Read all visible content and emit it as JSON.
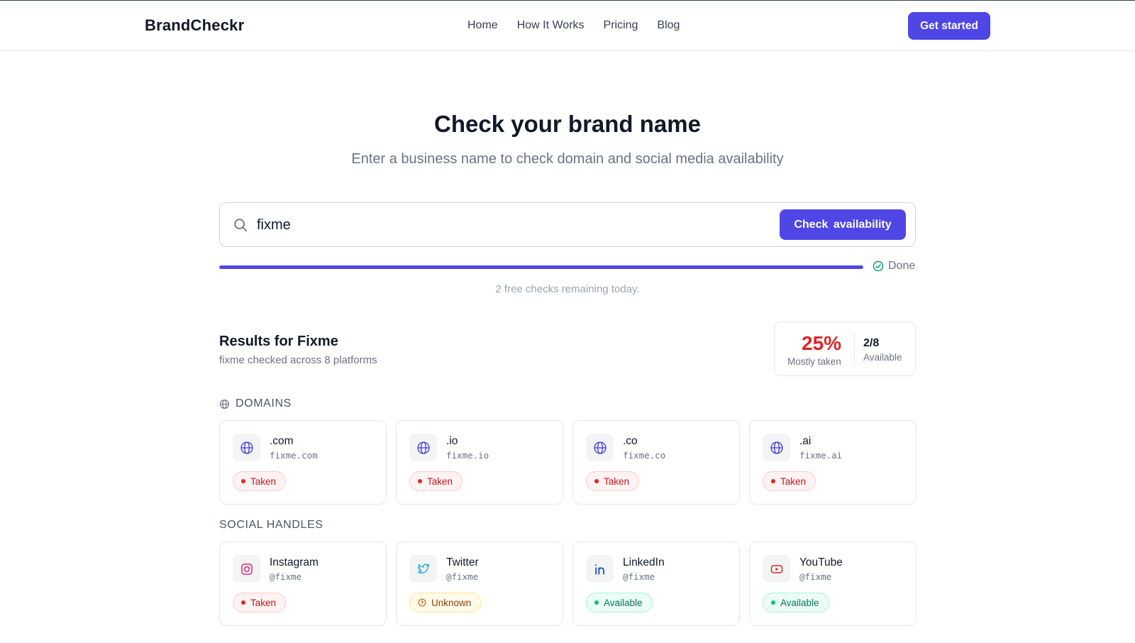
{
  "brand": "BrandCheckr",
  "nav": [
    "Home",
    "How It Works",
    "Pricing",
    "Blog"
  ],
  "cta": "Get started",
  "hero": {
    "title": "Check your brand name",
    "subtitle": "Enter a business name to check domain and social media availability"
  },
  "search": {
    "value": "fixme",
    "button": "Check  availability"
  },
  "progress": {
    "percent": 100,
    "status": "Done"
  },
  "remaining": "2 free checks remaining today.",
  "results": {
    "title": "Results for Fixme",
    "subtitle": "fixme checked across 8 platforms",
    "score": "25%",
    "score_label": "Mostly taken",
    "available_count": "2/8",
    "available_label": "Available"
  },
  "domains": {
    "heading": "DOMAINS",
    "items": [
      {
        "name": ".com",
        "value": "fixme.com",
        "status": "Taken"
      },
      {
        "name": ".io",
        "value": "fixme.io",
        "status": "Taken"
      },
      {
        "name": ".co",
        "value": "fixme.co",
        "status": "Taken"
      },
      {
        "name": ".ai",
        "value": "fixme.ai",
        "status": "Taken"
      }
    ]
  },
  "social": {
    "heading": "SOCIAL HANDLES",
    "items": [
      {
        "name": "Instagram",
        "value": "@fixme",
        "status": "Taken",
        "icon": "instagram-icon"
      },
      {
        "name": "Twitter",
        "value": "@fixme",
        "status": "Unknown",
        "icon": "twitter-icon"
      },
      {
        "name": "LinkedIn",
        "value": "@fixme",
        "status": "Available",
        "icon": "linkedin-icon"
      },
      {
        "name": "YouTube",
        "value": "@fixme",
        "status": "Available",
        "icon": "youtube-icon"
      }
    ]
  },
  "colors": {
    "accent": "#4f46e5",
    "taken": "#dc2626",
    "available": "#10b981",
    "unknown": "#d97706"
  }
}
